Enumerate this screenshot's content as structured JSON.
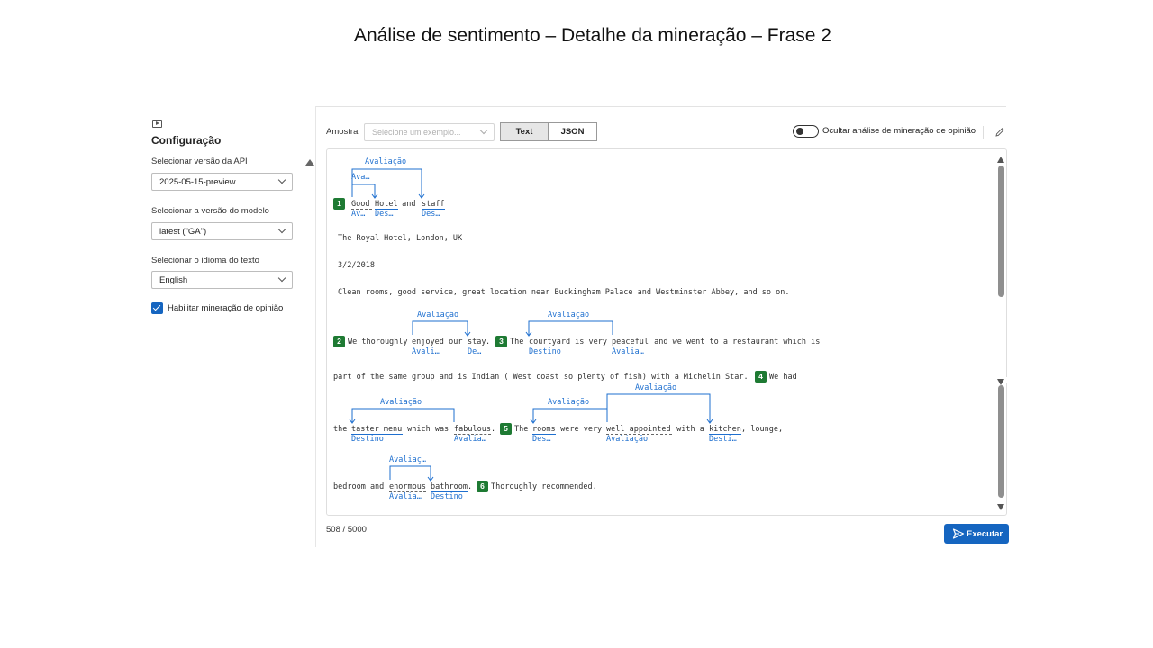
{
  "slide": {
    "title": "Análise de sentimento – Detalhe da mineração – Frase 2"
  },
  "sidebar": {
    "title": "Configuração",
    "api_version": {
      "label": "Selecionar versão da API",
      "value": "2025-05-15-preview"
    },
    "model_version": {
      "label": "Selecionar a versão do modelo",
      "value": "latest (\"GA\")"
    },
    "text_language": {
      "label": "Selecionar o idioma do texto",
      "value": "English"
    },
    "opinion_mining": {
      "label": "Habilitar mineração de opinião",
      "checked": true
    }
  },
  "toolbar": {
    "sample_label": "Amostra",
    "sample_placeholder": "Selecione um exemplo...",
    "view_text": "Text",
    "view_json": "JSON",
    "hide_toggle_label": "Ocultar análise de mineração de opinião"
  },
  "editor": {
    "lines": {
      "l1a": "Good",
      "l1b": "Hotel",
      "l1c": " and ",
      "l1d": "staff",
      "l2": "The Royal Hotel, London, UK",
      "l3": "3/2/2018",
      "l4": "Clean rooms, good service, great location near Buckingham Palace and Westminster Abbey, and so on.",
      "l5a": "We thoroughly ",
      "l5b": "enjoyed",
      "l5c": " our ",
      "l5d": "stay",
      "l5e": ".",
      "l5f": "The ",
      "l5g": "courtyard",
      "l5h": " is very ",
      "l5i": "peaceful",
      "l5j": " and we went to a restaurant which is",
      "l6": "part of the same group and is Indian ( West coast so plenty of fish) with a Michelin Star.",
      "l6b": "We had",
      "l7a": "the ",
      "l7b": "taster menu",
      "l7c": " which was ",
      "l7d": "fabulous",
      "l7e": ".",
      "l7f": "The ",
      "l7g": "rooms",
      "l7h": " were very ",
      "l7i": "well appointed",
      "l7j": " with a ",
      "l7k": "kitchen",
      "l7l": ", lounge,",
      "l8a": "bedroom and ",
      "l8b": "enormous",
      "l8c": " ",
      "l8d": "bathroom",
      "l8e": ".",
      "l8f": "Thoroughly recommended."
    },
    "badges": [
      "1",
      "2",
      "3",
      "4",
      "5",
      "6"
    ],
    "tags": {
      "t1_av": "Av…",
      "t1_des": "Des…",
      "t1_des2": "Des…",
      "t1_arc_small": "Ava…",
      "t1_arc_big": "Avaliação",
      "t2_avali": "Avali…",
      "t2_de": "De…",
      "t2_arc": "Avaliação",
      "t3_destino": "Destino",
      "t3_avalia": "Avalia…",
      "t3_arc": "Avaliação",
      "t4_destino": "Destino",
      "t4_avalia": "Avalia…",
      "t4_arc": "Avaliação",
      "t5_des": "Des…",
      "t5_avaliacao": "Avaliação",
      "t5_desti": "Desti…",
      "t5_arc": "Avaliação",
      "t5_arc2": "Avaliação",
      "t6_avalia": "Avalia…",
      "t6_destino": "Destino",
      "t6_arc": "Avaliaç…"
    }
  },
  "footer": {
    "char_count": "508 / 5000",
    "run_label": "Executar"
  },
  "colors": {
    "accent": "#1565c0",
    "badge": "#1e7a33",
    "tag": "#1e6fcf"
  }
}
